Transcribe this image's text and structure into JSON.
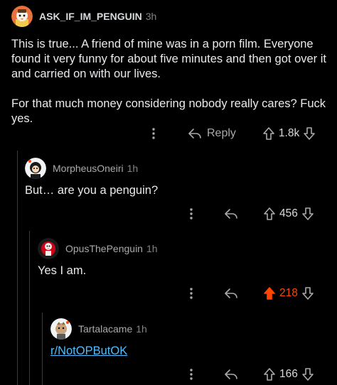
{
  "comments": [
    {
      "author": "ASK_IF_IM_PENGUIN",
      "age": "3h",
      "paragraphs": [
        "This is true... A friend of mine was in a porn film. Everyone found it very funny for about five minutes and then got over it and carried on with our lives.",
        "For that much money considering nobody really cares? Fuck yes."
      ],
      "reply_label": "Reply",
      "score": "1.8k",
      "upvoted": false
    },
    {
      "author": "MorpheusOneiri",
      "age": "1h",
      "text": "But… are you a penguin?",
      "score": "456",
      "upvoted": false
    },
    {
      "author": "OpusThePenguin",
      "age": "1h",
      "text": "Yes I am.",
      "score": "218",
      "upvoted": true
    },
    {
      "author": "Tartalacame",
      "age": "1h",
      "link_text": "r/NotOPButOK",
      "score": "166",
      "upvoted": false
    }
  ],
  "icons": {
    "more": "more-vertical-icon",
    "reply": "reply-arrow-icon",
    "upvote": "upvote-arrow-icon",
    "downvote": "downvote-arrow-icon"
  },
  "colors": {
    "background": "#000000",
    "text": "#d7dadc",
    "muted": "#818384",
    "upvote_active": "#ff4500",
    "link": "#4fbcff"
  }
}
